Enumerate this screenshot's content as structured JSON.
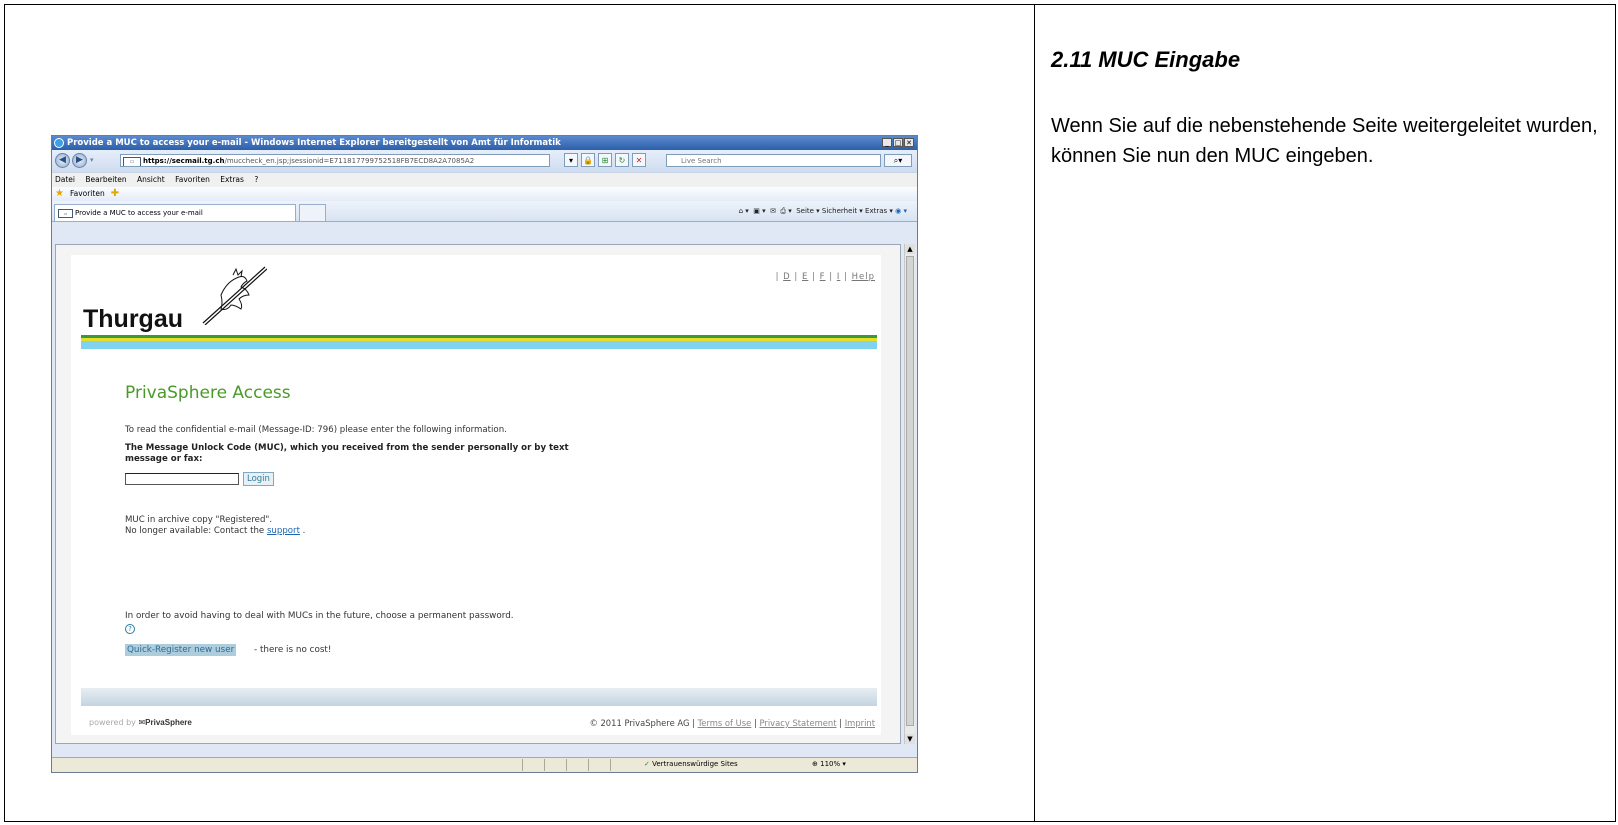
{
  "doc": {
    "heading": "2.11  MUC Eingabe",
    "body": "Wenn Sie auf die nebenstehende Seite weitergeleitet wurden, können Sie nun den MUC eingeben."
  },
  "browser": {
    "title": "Provide a MUC to access your e-mail - Windows Internet Explorer bereitgestellt von Amt für Informatik",
    "url_host": "https://secmail.tg.ch",
    "url_path": "/muccheck_en.jsp;jsessionid=E711817799752518FB7ECD8A2A7085A2",
    "search_placeholder": "Live Search",
    "menu": [
      "Datei",
      "Bearbeiten",
      "Ansicht",
      "Favoriten",
      "Extras",
      "?"
    ],
    "favorites_label": "Favoriten",
    "tab_title": "Provide a MUC to access your e-mail",
    "cmdbar": "Seite ▾  Sicherheit ▾  Extras ▾",
    "status_trusted": "Vertrauenswürdige Sites",
    "zoom": "110%"
  },
  "page": {
    "lang_links": [
      "D",
      "E",
      "F",
      "I"
    ],
    "help_link": "Help",
    "logo_text": "Thurgau",
    "heading": "PrivaSphere Access",
    "intro": "To read the confidential e-mail (Message-ID: 796) please enter the following information.",
    "muc_label": "The Message Unlock Code (MUC), which you received from the sender personally or by text message or fax:",
    "login_button": "Login",
    "archive_line1": "MUC in archive copy \"Registered\".",
    "archive_line2_prefix": "No longer available: Contact the",
    "support_link": "support",
    "archive_line2_suffix": " .",
    "future_text": "In order to avoid having to deal with MUCs in the future, choose a permanent password.",
    "quick_register": "Quick-Register new user",
    "no_cost": "- there is no cost!",
    "powered_prefix": "powered by",
    "powered_brand": "PrivaSphere",
    "copyright": "© 2011 PrivaSphere AG",
    "terms": "Terms of Use",
    "privacy": "Privacy Statement",
    "imprint": "Imprint"
  },
  "colors": {
    "stripe_green": "#3a9b35",
    "stripe_yellow": "#e8dd2a",
    "stripe_cyan": "#7fd3ee",
    "heading_green": "#4a9a2a"
  }
}
